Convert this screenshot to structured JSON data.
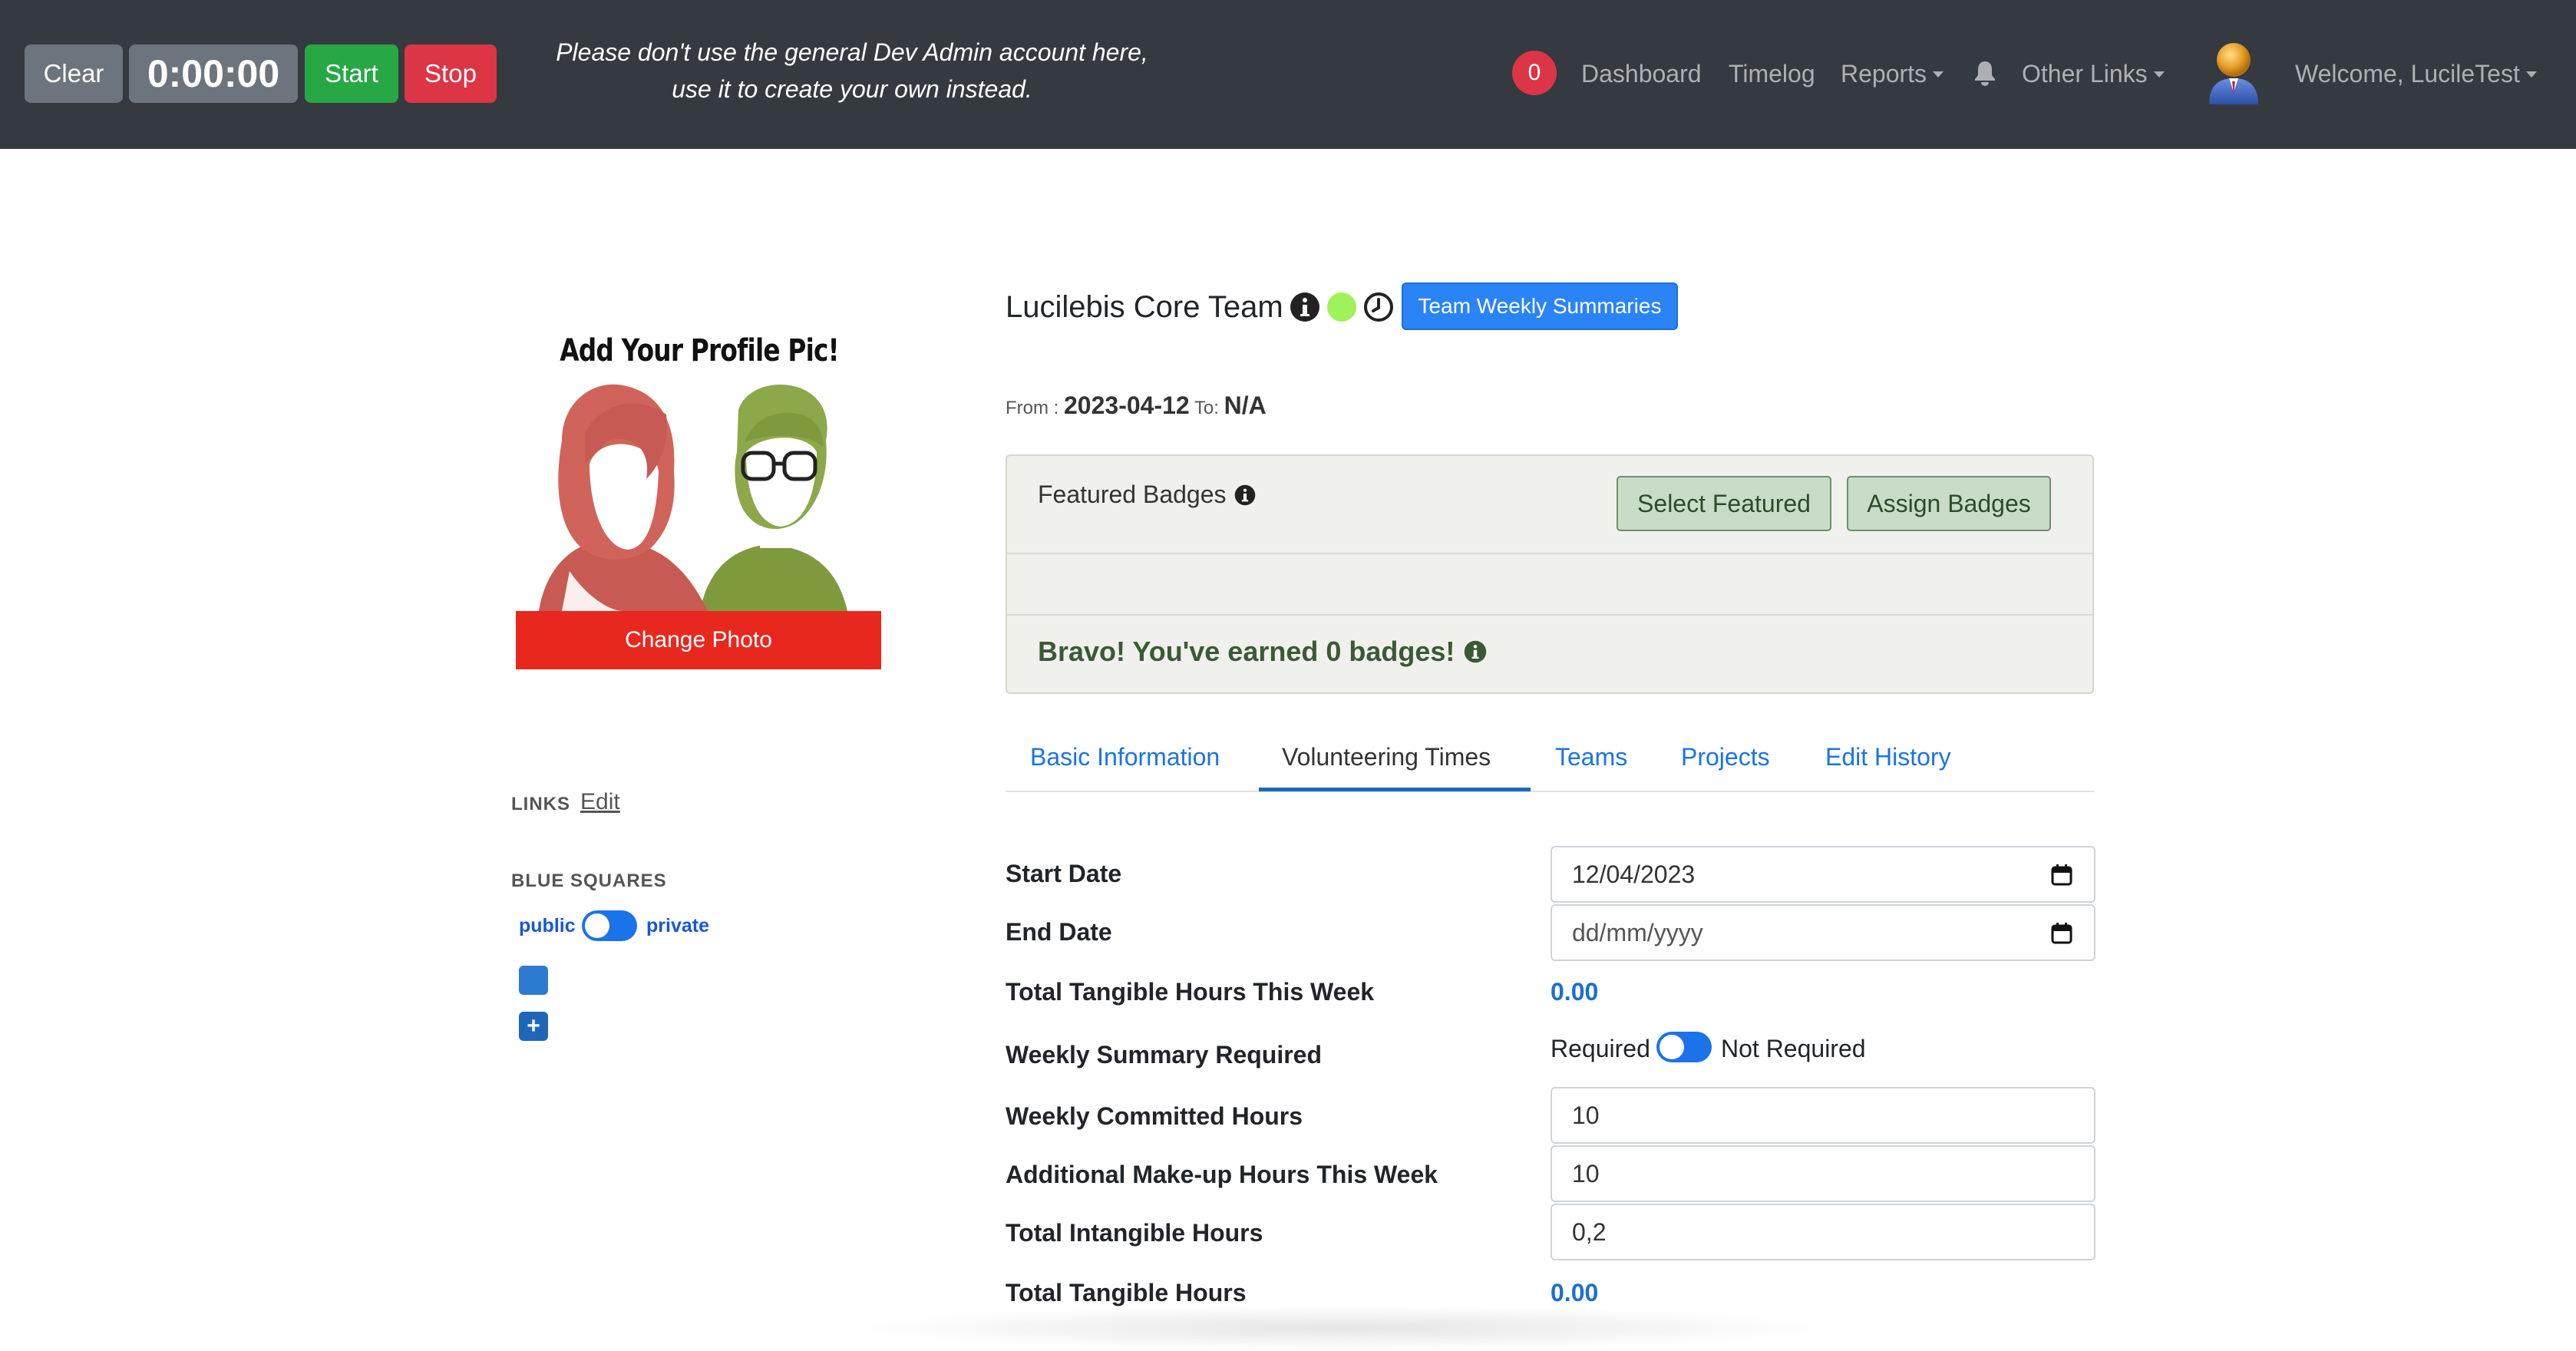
{
  "navbar": {
    "clear_label": "Clear",
    "timer": "0:00:00",
    "start_label": "Start",
    "stop_label": "Stop",
    "warning_line1": "Please don't use the general Dev Admin account here,",
    "warning_line2": "use it to create your own instead.",
    "notification_count": "0",
    "links": {
      "dashboard": "Dashboard",
      "timelog": "Timelog",
      "reports": "Reports",
      "other_links": "Other Links",
      "welcome": "Welcome, LucileTest"
    }
  },
  "profile": {
    "pic_title": "Add Your Profile Pic!",
    "change_photo": "Change Photo",
    "links_label": "LINKS",
    "links_edit": "Edit",
    "blue_squares_label": "BLUE SQUARES",
    "public_label": "public",
    "private_label": "private",
    "add_symbol": "+"
  },
  "header": {
    "team_name": "Lucilebis Core Team",
    "team_summaries_label": "Team Weekly Summaries",
    "status_color": "#9ef25a",
    "from_label": "From :",
    "from_date": "2023-04-12",
    "to_label": "To:",
    "to_date": "N/A"
  },
  "badges": {
    "featured_label": "Featured Badges",
    "select_featured": "Select Featured",
    "assign_badges": "Assign Badges",
    "earned_message": "Bravo! You've earned 0 badges!"
  },
  "tabs": [
    {
      "label": "Basic Information",
      "active": false
    },
    {
      "label": "Volunteering Times",
      "active": true
    },
    {
      "label": "Teams",
      "active": false
    },
    {
      "label": "Projects",
      "active": false
    },
    {
      "label": "Edit History",
      "active": false
    }
  ],
  "form": {
    "start_date_label": "Start Date",
    "start_date_value": "12/04/2023",
    "end_date_label": "End Date",
    "end_date_placeholder": "dd/mm/yyyy",
    "tangible_week_label": "Total Tangible Hours This Week",
    "tangible_week_value": "0.00",
    "summary_required_label": "Weekly Summary Required",
    "required_word": "Required",
    "not_required_word": "Not Required",
    "committed_label": "Weekly Committed Hours",
    "committed_value": "10",
    "makeup_label": "Additional Make-up Hours This Week",
    "makeup_value": "10",
    "intangible_label": "Total Intangible Hours",
    "intangible_value": "0,2",
    "tangible_total_label": "Total Tangible Hours",
    "tangible_total_value": "0.00"
  },
  "colors": {
    "navbar_bg": "#343a40",
    "accent_blue": "#1a73e8",
    "change_photo_red": "#e8281e",
    "start_green": "#28a745",
    "stop_red": "#dc3545"
  }
}
